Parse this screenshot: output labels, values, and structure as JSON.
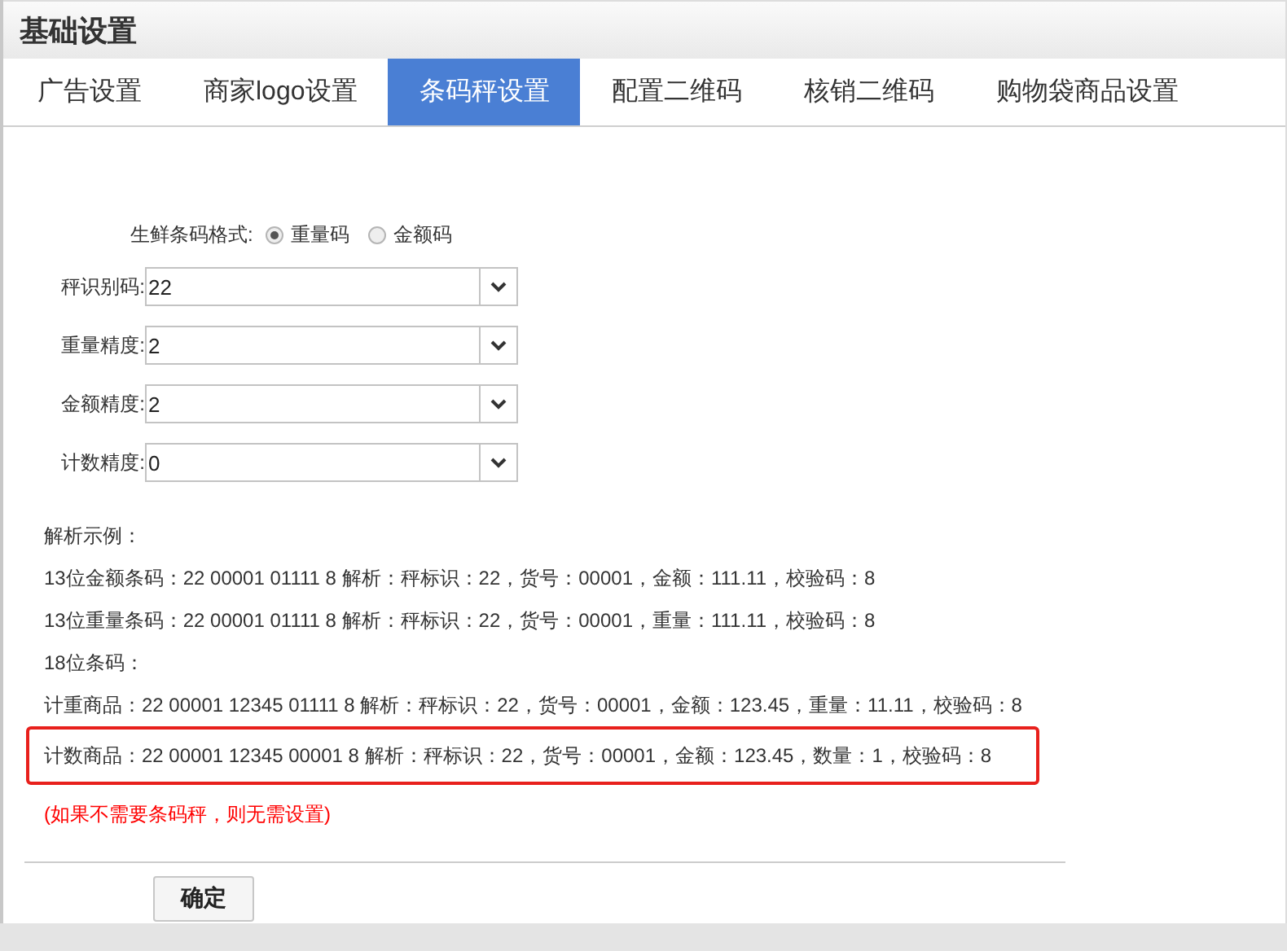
{
  "header": {
    "title": "基础设置"
  },
  "tabs": [
    {
      "label": "广告设置",
      "selected": false
    },
    {
      "label": "商家logo设置",
      "selected": false
    },
    {
      "label": "条码秤设置",
      "selected": true
    },
    {
      "label": "配置二维码",
      "selected": false
    },
    {
      "label": "核销二维码",
      "selected": false
    },
    {
      "label": "购物袋商品设置",
      "selected": false
    }
  ],
  "format": {
    "label": "生鲜条码格式:",
    "options": [
      {
        "label": "重量码",
        "selected": true
      },
      {
        "label": "金额码",
        "selected": false
      }
    ]
  },
  "selects": [
    {
      "label": "秤识别码:",
      "value": "22"
    },
    {
      "label": "重量精度:",
      "value": "2"
    },
    {
      "label": "金额精度:",
      "value": "2"
    },
    {
      "label": "计数精度:",
      "value": "0"
    }
  ],
  "examples": [
    {
      "text": "解析示例：",
      "highlighted": false
    },
    {
      "text": "13位金额条码：22 00001 01111 8 解析：秤标识：22，货号：00001，金额：111.11，校验码：8",
      "highlighted": false
    },
    {
      "text": "13位重量条码：22 00001 01111 8 解析：秤标识：22，货号：00001，重量：111.11，校验码：8",
      "highlighted": false
    },
    {
      "text": "18位条码：",
      "highlighted": false
    },
    {
      "text": "计重商品：22 00001 12345 01111 8 解析：秤标识：22，货号：00001，金额：123.45，重量：11.11，校验码：8",
      "highlighted": false
    },
    {
      "text": "计数商品：22 00001 12345 00001 8 解析：秤标识：22，货号：00001，金额：123.45，数量：1，校验码：8",
      "highlighted": true
    }
  ],
  "note": "(如果不需要条码秤，则无需设置)",
  "confirm_button": "确定"
}
